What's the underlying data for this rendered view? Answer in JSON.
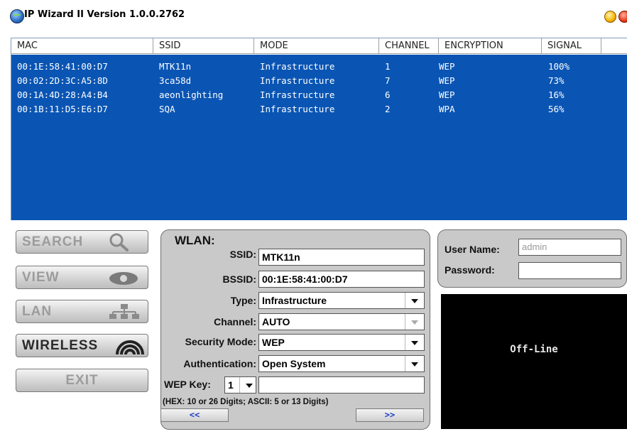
{
  "window": {
    "title": "IP Wizard II  Version 1.0.0.2762",
    "icon": "globe-network-icon"
  },
  "table": {
    "columns": [
      "MAC",
      "SSID",
      "MODE",
      "CHANNEL",
      "ENCRYPTION",
      "SIGNAL"
    ],
    "rows": [
      [
        "00:1E:58:41:00:D7",
        "MTK11n",
        "Infrastructure",
        "1",
        "WEP",
        "100%"
      ],
      [
        "00:02:2D:3C:A5:8D",
        "3ca58d",
        "Infrastructure",
        "7",
        "WEP",
        "73%"
      ],
      [
        "00:1A:4D:28:A4:B4",
        "aeonlighting",
        "Infrastructure",
        "6",
        "WEP",
        "16%"
      ],
      [
        "00:1B:11:D5:E6:D7",
        "SQA",
        "Infrastructure",
        "2",
        "WPA",
        "56%"
      ]
    ],
    "background_color": "#0a55b4"
  },
  "nav": {
    "search": "SEARCH",
    "view": "VIEW",
    "lan": "LAN",
    "wireless": "WIRELESS",
    "exit": "EXIT",
    "active": "wireless"
  },
  "wlan": {
    "title": "WLAN:",
    "ssid_label": "SSID:",
    "ssid_value": "MTK11n",
    "bssid_label": "BSSID:",
    "bssid_value": "00:1E:58:41:00:D7",
    "type_label": "Type:",
    "type_value": "Infrastructure",
    "channel_label": "Channel:",
    "channel_value": "AUTO",
    "security_label": "Security Mode:",
    "security_value": "WEP",
    "auth_label": "Authentication:",
    "auth_value": "Open System",
    "wepkey_label": "WEP Key:",
    "wepkey_index": "1",
    "wepkey_value": "",
    "hint": "(HEX: 10 or 26 Digits; ASCII: 5 or 13 Digits)",
    "prev_label": "<<",
    "next_label": ">>"
  },
  "login": {
    "username_label": "User Name:",
    "username_placeholder": "admin",
    "password_label": "Password:"
  },
  "status": {
    "text": "Off-Line"
  }
}
